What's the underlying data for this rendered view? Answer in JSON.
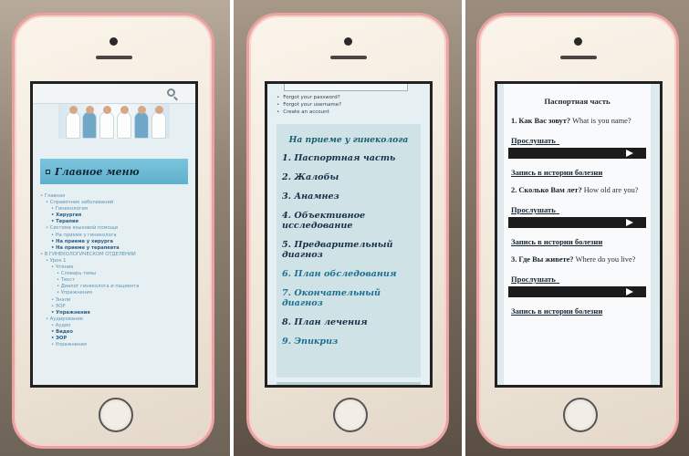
{
  "panel1": {
    "menu_title": "Главное меню",
    "tree": [
      {
        "text": "Главная",
        "level": 0,
        "bold": false
      },
      {
        "text": "Справочник заболеваний",
        "level": 1,
        "bold": false
      },
      {
        "text": "Гинекология",
        "level": 2,
        "bold": false
      },
      {
        "text": "Хирургия",
        "level": 2,
        "bold": true
      },
      {
        "text": "Терапия",
        "level": 2,
        "bold": true
      },
      {
        "text": "Система языковой помощи",
        "level": 1,
        "bold": false
      },
      {
        "text": "На приеме у гинеколога",
        "level": 2,
        "bold": false
      },
      {
        "text": "На приеме у хирурга",
        "level": 2,
        "bold": true
      },
      {
        "text": "На приеме у терапевта",
        "level": 2,
        "bold": true
      },
      {
        "text": "В ГИНЕКОЛОГИЧЕСКОМ ОТДЕЛЕНИИ",
        "level": 0,
        "bold": false
      },
      {
        "text": "Урок 1",
        "level": 1,
        "bold": false
      },
      {
        "text": "Чтение",
        "level": 2,
        "bold": false
      },
      {
        "text": "Словарь темы",
        "level": 3,
        "bold": false
      },
      {
        "text": "Текст",
        "level": 3,
        "bold": false
      },
      {
        "text": "Диалог гинеколога и пациента",
        "level": 3,
        "bold": false
      },
      {
        "text": "Упражнения",
        "level": 3,
        "bold": false
      },
      {
        "text": "Знали",
        "level": 2,
        "bold": false
      },
      {
        "text": "ЭОР",
        "level": 2,
        "bold": false
      },
      {
        "text": "Упражнения",
        "level": 2,
        "bold": true
      },
      {
        "text": "Аудирование",
        "level": 1,
        "bold": false
      },
      {
        "text": "Аудио",
        "level": 2,
        "bold": false
      },
      {
        "text": "Видео",
        "level": 2,
        "bold": true
      },
      {
        "text": "ЭОР",
        "level": 2,
        "bold": true
      },
      {
        "text": "Упражнения",
        "level": 2,
        "bold": false
      }
    ]
  },
  "panel2": {
    "links": [
      "Forgot your password?",
      "Forgot your username?",
      "Create an account"
    ],
    "title": "На приеме у гинеколога",
    "items": [
      {
        "text": "1. Паспортная часть",
        "highlight": false
      },
      {
        "text": "2. Жалобы",
        "highlight": false
      },
      {
        "text": "3. Анамнез",
        "highlight": false
      },
      {
        "text": "4. Объективное исследование",
        "highlight": false
      },
      {
        "text": "5. Предварительный диагноз",
        "highlight": false
      },
      {
        "text": "6. План обследования",
        "highlight": true
      },
      {
        "text": "7. Окончательный диагноз",
        "highlight": true
      },
      {
        "text": "8. План лечения",
        "highlight": false
      },
      {
        "text": "9. Эпикриз",
        "highlight": true
      }
    ]
  },
  "panel3": {
    "title": "Паспортная часть",
    "listen_label": "Прослушать",
    "record_label": "Запись в истории болезни",
    "questions": [
      {
        "ru": "1. Как Вас зовут?",
        "en": "What is you name?"
      },
      {
        "ru": "2. Сколько Вам лет?",
        "en": "How old are you?"
      },
      {
        "ru": "3. Где Вы живете?",
        "en": "Where do you live?"
      }
    ]
  }
}
